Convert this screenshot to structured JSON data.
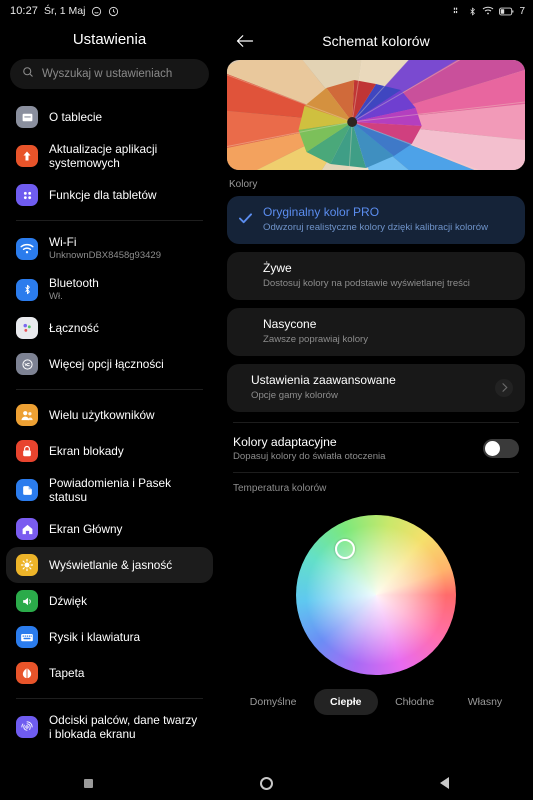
{
  "status_bar": {
    "time": "10:27",
    "date": "Śr, 1 Maj",
    "icons_left": [
      "face-icon",
      "clock-icon"
    ],
    "icons_right": [
      "signal-icon",
      "bluetooth-icon",
      "wifi-icon",
      "battery-icon"
    ],
    "battery_level": "7"
  },
  "sidebar": {
    "title": "Ustawienia",
    "search": {
      "placeholder": "Wyszukaj w ustawieniach",
      "icon": "search-icon"
    },
    "groups": [
      {
        "items": [
          {
            "label": "O tablecie",
            "sub": "",
            "icon": "tablet-icon",
            "color": "#8a8f9e",
            "selected": false
          },
          {
            "label": "Aktualizacje aplikacji systemowych",
            "sub": "",
            "icon": "update-arrow-icon",
            "color": "#e8542a",
            "selected": false
          },
          {
            "label": "Funkcje dla tabletów",
            "sub": "",
            "icon": "grid-dots-icon",
            "color": "#6f5cf0",
            "selected": false
          }
        ]
      },
      {
        "items": [
          {
            "label": "Wi-Fi",
            "sub": "UnknownDBX8458g93429",
            "icon": "wifi-icon",
            "color": "#2b7ced",
            "selected": false
          },
          {
            "label": "Bluetooth",
            "sub": "Wł.",
            "icon": "bluetooth-icon",
            "color": "#2b7ced",
            "selected": false
          },
          {
            "label": "Łączność",
            "sub": "",
            "icon": "connectivity-dots-icon",
            "color": "#e9eaee",
            "selected": false
          },
          {
            "label": "Więcej opcji łączności",
            "sub": "",
            "icon": "more-connectivity-icon",
            "color": "#7d8293",
            "selected": false
          }
        ]
      },
      {
        "items": [
          {
            "label": "Wielu użytkowników",
            "sub": "",
            "icon": "users-icon",
            "color": "#eda033",
            "selected": false
          },
          {
            "label": "Ekran blokady",
            "sub": "",
            "icon": "lock-icon",
            "color": "#e8442e",
            "selected": false
          },
          {
            "label": "Powiadomienia i Pasek statusu",
            "sub": "",
            "icon": "notification-icon",
            "color": "#2b7ced",
            "selected": false
          },
          {
            "label": "Ekran Główny",
            "sub": "",
            "icon": "home-icon",
            "color": "#7a5cf0",
            "selected": false
          },
          {
            "label": "Wyświetlanie & jasność",
            "sub": "",
            "icon": "brightness-icon",
            "color": "#edb429",
            "selected": true
          },
          {
            "label": "Dźwięk",
            "sub": "",
            "icon": "sound-icon",
            "color": "#2bab4a",
            "selected": false
          },
          {
            "label": "Rysik i klawiatura",
            "sub": "",
            "icon": "keyboard-icon",
            "color": "#2b7ced",
            "selected": false
          },
          {
            "label": "Tapeta",
            "sub": "",
            "icon": "wallpaper-icon",
            "color": "#e8542a",
            "selected": false
          }
        ]
      },
      {
        "items": [
          {
            "label": "Odciski palców, dane twarzy i blokada ekranu",
            "sub": "",
            "icon": "fingerprint-icon",
            "color": "#6f5cf0",
            "selected": false
          }
        ]
      }
    ]
  },
  "content": {
    "back_icon": "back-arrow-icon",
    "title": "Schemat kolorów",
    "hero_label": "Kolory",
    "hero_image": "colored-pencils-photo",
    "scheme_options": [
      {
        "title": "Oryginalny kolor PRO",
        "sub": "Odwzoruj realistyczne kolory dzięki kalibracji kolorów",
        "selected": true
      },
      {
        "title": "Żywe",
        "sub": "Dostosuj kolory na podstawie wyświetlanej treści",
        "selected": false
      },
      {
        "title": "Nasycone",
        "sub": "Zawsze poprawiaj kolory",
        "selected": false
      }
    ],
    "advanced": {
      "title": "Ustawienia zaawansowane",
      "sub": "Opcje gamy kolorów",
      "chevron": "chevron-right-icon"
    },
    "adaptive": {
      "title": "Kolory adaptacyjne",
      "sub": "Dopasuj kolory do światła otoczenia",
      "enabled": false
    },
    "temperature": {
      "label": "Temperatura kolorów",
      "presets": [
        {
          "label": "Domyślne",
          "selected": false
        },
        {
          "label": "Ciepłe",
          "selected": true
        },
        {
          "label": "Chłodne",
          "selected": false
        },
        {
          "label": "Własny",
          "selected": false
        }
      ]
    },
    "accent_color": "#5b8def",
    "selected_card_bg": "#152338"
  },
  "navbar": {
    "recents": "recents-square-icon",
    "home": "home-circle-icon",
    "back": "back-triangle-icon"
  }
}
